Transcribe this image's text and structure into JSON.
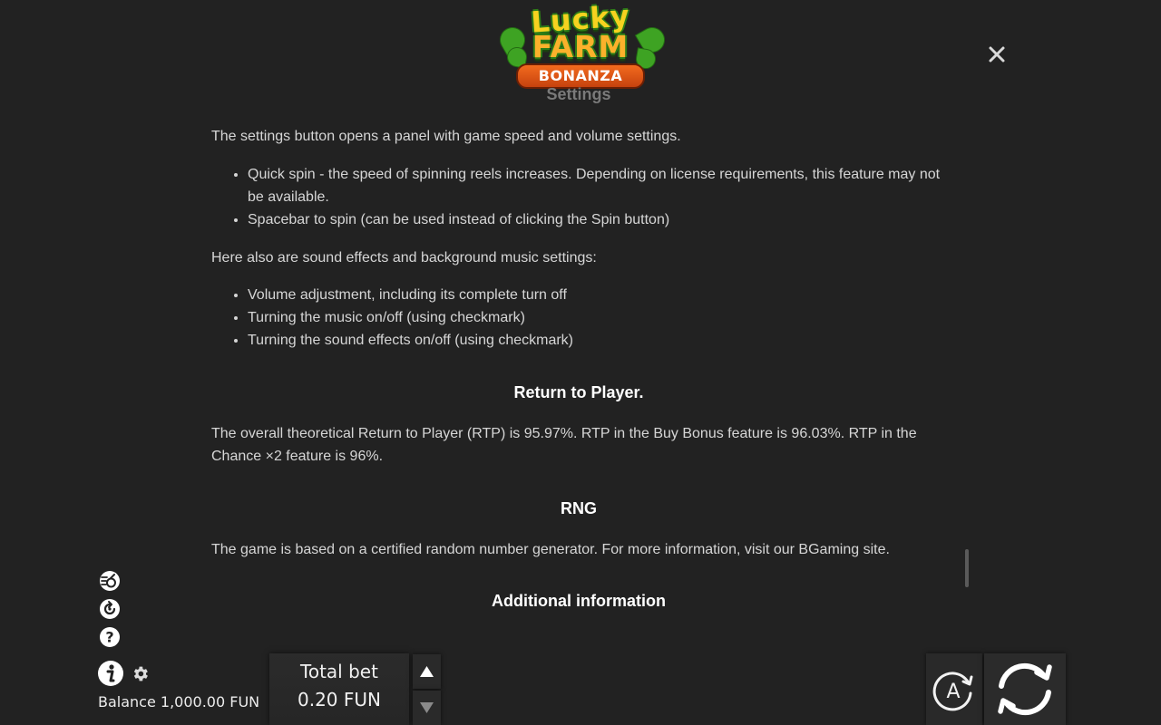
{
  "logo": {
    "line1": "Lucky",
    "line2": "FARM",
    "line3": "BONANZA"
  },
  "rules": {
    "settings_heading": "Settings",
    "settings_intro": "The settings button opens a panel with game speed and volume settings.",
    "settings_bullets": [
      "Quick spin - the speed of spinning reels increases. Depending on license requirements, this feature may not be available.",
      "Spacebar to spin (can be used instead of clicking the Spin button)"
    ],
    "sound_intro": "Here also are sound effects and background music settings:",
    "sound_bullets": [
      "Volume adjustment, including its complete turn off",
      "Turning the music on/off (using checkmark)",
      "Turning the sound effects on/off (using checkmark)"
    ],
    "rtp_heading": "Return to Player.",
    "rtp_text": "The overall theoretical Return to Player (RTP) is 95.97%. RTP in the Buy Bonus feature is 96.03%. RTP in the Chance ×2 feature is 96%.",
    "rng_heading": "RNG",
    "rng_text": "The game is based on a certified random number generator. For more information, visit our BGaming site.",
    "additional_heading": "Additional information"
  },
  "controls": {
    "balance": "Balance 1,000.00 FUN",
    "total_bet_label": "Total bet",
    "total_bet_value": "0.20 FUN",
    "autoplay_letter": "A"
  },
  "icons": {
    "close": "close-icon",
    "turbo": "turbo-spin-icon",
    "quick": "quick-spin-icon",
    "help": "help-icon",
    "info": "info-icon",
    "settings": "gear-icon",
    "bet_up": "triangle-up-icon",
    "bet_down": "triangle-down-icon",
    "autoplay": "autoplay-icon",
    "spin": "spin-icon"
  },
  "colors": {
    "background": "#222222",
    "text": "#d6d6d6",
    "heading": "#ffffff"
  }
}
